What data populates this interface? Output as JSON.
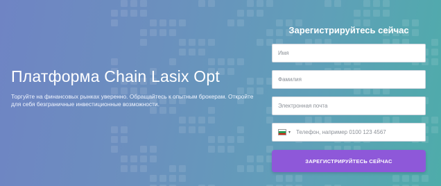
{
  "hero": {
    "title": "Платформа Chain Lasix Opt",
    "description": "Торгуйте на финансовых рынках уверенно. Обращайтесь к опытным брокерам. Откройте для себя безграничные инвестиционные возможности."
  },
  "form": {
    "heading": "Зарегистрируйтесь сейчас",
    "first_name_placeholder": "Имя",
    "last_name_placeholder": "Фамилия",
    "email_placeholder": "Электронная почта",
    "phone_placeholder": "Телефон, например 0100 123 4567",
    "phone_country_flag": "bg-flag-icon",
    "submit_label": "ЗАРЕГИСТРИРУЙТЕСЬ СЕЙЧАС"
  },
  "colors": {
    "submit_button": "#8e58d9",
    "background_start": "#6f84c4",
    "background_end": "#4eacaa"
  }
}
